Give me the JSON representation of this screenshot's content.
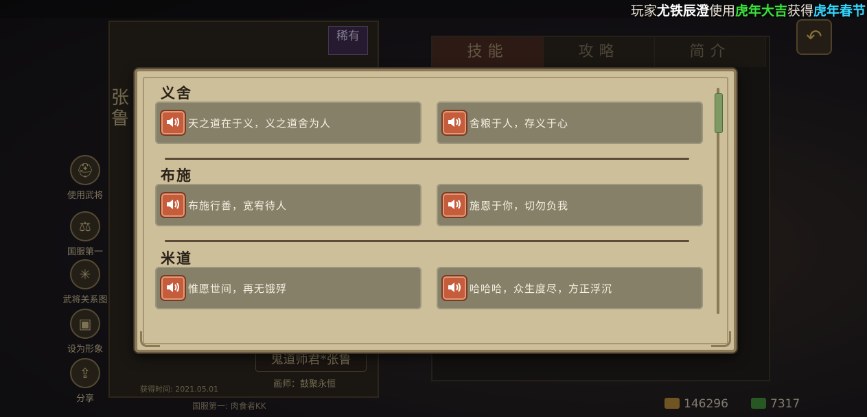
{
  "marquee": {
    "prefix": "玩家",
    "player": "尤铁辰澄",
    "verb": "使用",
    "item": "虎年大吉",
    "gain": "获得",
    "event": "虎年春节"
  },
  "hero": {
    "name": "张鲁",
    "rarity": "稀有",
    "skin_title": "鬼道师君*张鲁",
    "painter": "画师：鼓聚永恒",
    "obtained": "获得时间: 2021.05.01",
    "server_rank": "国服第一: 肉食者KK"
  },
  "sidebar": [
    {
      "label": "使用武将",
      "icon": "helmet-icon"
    },
    {
      "label": "国服第一",
      "icon": "scales-icon"
    },
    {
      "label": "武将关系图",
      "icon": "network-icon"
    },
    {
      "label": "设为形象",
      "icon": "portrait-icon"
    },
    {
      "label": "分享",
      "icon": "share-icon"
    }
  ],
  "tabs": [
    "技能",
    "攻略",
    "简介"
  ],
  "resources": {
    "gold": "146296",
    "jade": "7317"
  },
  "dialog": {
    "sections": [
      {
        "title": "义舍",
        "lines": [
          "天之道在于义，义之道舍为人",
          "舍粮于人，存义于心"
        ]
      },
      {
        "title": "布施",
        "lines": [
          "布施行善，宽宥待人",
          "施恩于你，切勿负我"
        ]
      },
      {
        "title": "米道",
        "lines": [
          "惟愿世间，再无饿殍",
          "哈哈哈，众生度尽，方正浮沉"
        ]
      }
    ]
  },
  "colors": {
    "speaker": "#c55c3c",
    "card": "#878068",
    "dialog": "#cdbf9a"
  }
}
